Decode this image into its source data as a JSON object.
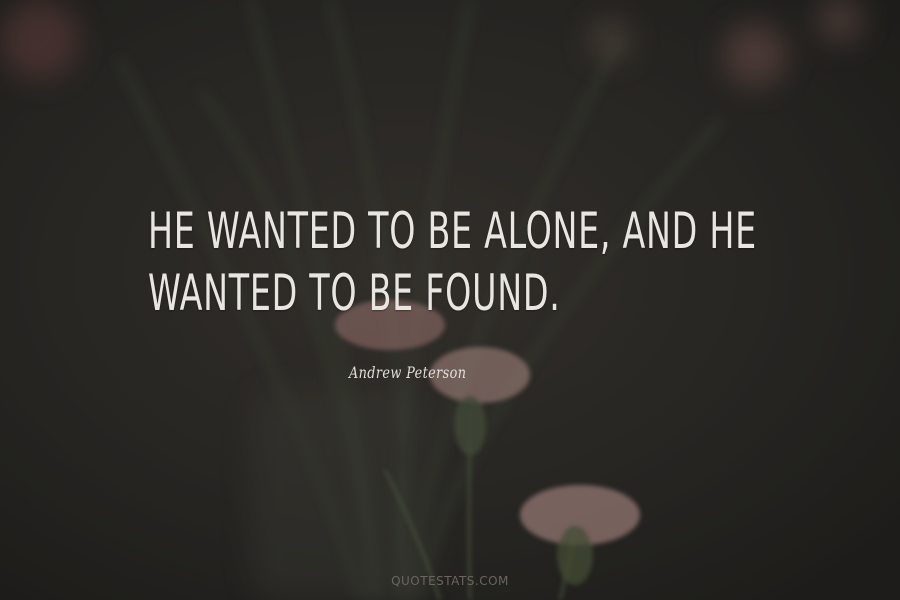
{
  "quote": {
    "lines": [
      "HE WANTED TO BE ALONE, AND HE",
      "WANTED TO BE FOUND."
    ]
  },
  "author": "Andrew Peterson",
  "watermark": "QUOTESTATS.COM",
  "colors": {
    "background": "#2b2926",
    "text": "#e9e6e2",
    "flower_pink": "#c98a86",
    "stem_green": "#4b5a43"
  }
}
